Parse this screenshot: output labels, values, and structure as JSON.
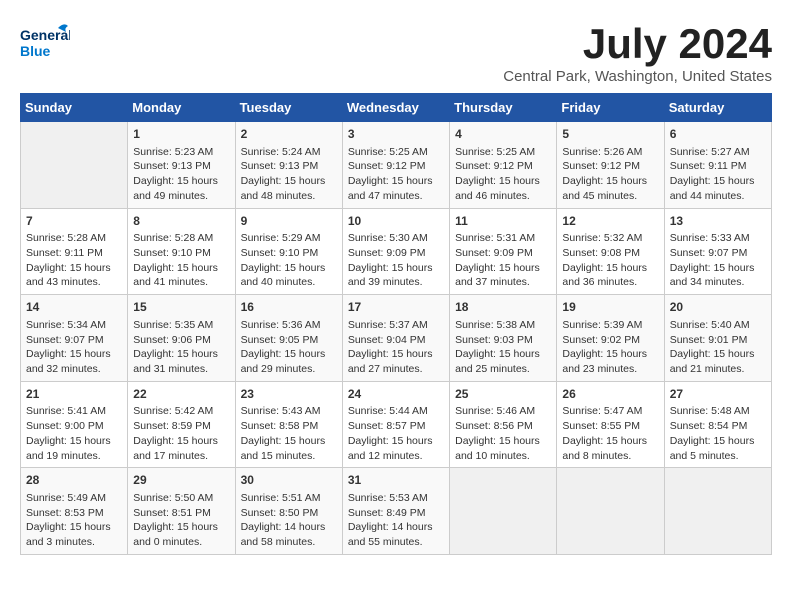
{
  "logo": {
    "line1": "General",
    "line2": "Blue"
  },
  "title": "July 2024",
  "subtitle": "Central Park, Washington, United States",
  "headers": [
    "Sunday",
    "Monday",
    "Tuesday",
    "Wednesday",
    "Thursday",
    "Friday",
    "Saturday"
  ],
  "weeks": [
    [
      {
        "day": "",
        "info": ""
      },
      {
        "day": "1",
        "info": "Sunrise: 5:23 AM\nSunset: 9:13 PM\nDaylight: 15 hours\nand 49 minutes."
      },
      {
        "day": "2",
        "info": "Sunrise: 5:24 AM\nSunset: 9:13 PM\nDaylight: 15 hours\nand 48 minutes."
      },
      {
        "day": "3",
        "info": "Sunrise: 5:25 AM\nSunset: 9:12 PM\nDaylight: 15 hours\nand 47 minutes."
      },
      {
        "day": "4",
        "info": "Sunrise: 5:25 AM\nSunset: 9:12 PM\nDaylight: 15 hours\nand 46 minutes."
      },
      {
        "day": "5",
        "info": "Sunrise: 5:26 AM\nSunset: 9:12 PM\nDaylight: 15 hours\nand 45 minutes."
      },
      {
        "day": "6",
        "info": "Sunrise: 5:27 AM\nSunset: 9:11 PM\nDaylight: 15 hours\nand 44 minutes."
      }
    ],
    [
      {
        "day": "7",
        "info": "Sunrise: 5:28 AM\nSunset: 9:11 PM\nDaylight: 15 hours\nand 43 minutes."
      },
      {
        "day": "8",
        "info": "Sunrise: 5:28 AM\nSunset: 9:10 PM\nDaylight: 15 hours\nand 41 minutes."
      },
      {
        "day": "9",
        "info": "Sunrise: 5:29 AM\nSunset: 9:10 PM\nDaylight: 15 hours\nand 40 minutes."
      },
      {
        "day": "10",
        "info": "Sunrise: 5:30 AM\nSunset: 9:09 PM\nDaylight: 15 hours\nand 39 minutes."
      },
      {
        "day": "11",
        "info": "Sunrise: 5:31 AM\nSunset: 9:09 PM\nDaylight: 15 hours\nand 37 minutes."
      },
      {
        "day": "12",
        "info": "Sunrise: 5:32 AM\nSunset: 9:08 PM\nDaylight: 15 hours\nand 36 minutes."
      },
      {
        "day": "13",
        "info": "Sunrise: 5:33 AM\nSunset: 9:07 PM\nDaylight: 15 hours\nand 34 minutes."
      }
    ],
    [
      {
        "day": "14",
        "info": "Sunrise: 5:34 AM\nSunset: 9:07 PM\nDaylight: 15 hours\nand 32 minutes."
      },
      {
        "day": "15",
        "info": "Sunrise: 5:35 AM\nSunset: 9:06 PM\nDaylight: 15 hours\nand 31 minutes."
      },
      {
        "day": "16",
        "info": "Sunrise: 5:36 AM\nSunset: 9:05 PM\nDaylight: 15 hours\nand 29 minutes."
      },
      {
        "day": "17",
        "info": "Sunrise: 5:37 AM\nSunset: 9:04 PM\nDaylight: 15 hours\nand 27 minutes."
      },
      {
        "day": "18",
        "info": "Sunrise: 5:38 AM\nSunset: 9:03 PM\nDaylight: 15 hours\nand 25 minutes."
      },
      {
        "day": "19",
        "info": "Sunrise: 5:39 AM\nSunset: 9:02 PM\nDaylight: 15 hours\nand 23 minutes."
      },
      {
        "day": "20",
        "info": "Sunrise: 5:40 AM\nSunset: 9:01 PM\nDaylight: 15 hours\nand 21 minutes."
      }
    ],
    [
      {
        "day": "21",
        "info": "Sunrise: 5:41 AM\nSunset: 9:00 PM\nDaylight: 15 hours\nand 19 minutes."
      },
      {
        "day": "22",
        "info": "Sunrise: 5:42 AM\nSunset: 8:59 PM\nDaylight: 15 hours\nand 17 minutes."
      },
      {
        "day": "23",
        "info": "Sunrise: 5:43 AM\nSunset: 8:58 PM\nDaylight: 15 hours\nand 15 minutes."
      },
      {
        "day": "24",
        "info": "Sunrise: 5:44 AM\nSunset: 8:57 PM\nDaylight: 15 hours\nand 12 minutes."
      },
      {
        "day": "25",
        "info": "Sunrise: 5:46 AM\nSunset: 8:56 PM\nDaylight: 15 hours\nand 10 minutes."
      },
      {
        "day": "26",
        "info": "Sunrise: 5:47 AM\nSunset: 8:55 PM\nDaylight: 15 hours\nand 8 minutes."
      },
      {
        "day": "27",
        "info": "Sunrise: 5:48 AM\nSunset: 8:54 PM\nDaylight: 15 hours\nand 5 minutes."
      }
    ],
    [
      {
        "day": "28",
        "info": "Sunrise: 5:49 AM\nSunset: 8:53 PM\nDaylight: 15 hours\nand 3 minutes."
      },
      {
        "day": "29",
        "info": "Sunrise: 5:50 AM\nSunset: 8:51 PM\nDaylight: 15 hours\nand 0 minutes."
      },
      {
        "day": "30",
        "info": "Sunrise: 5:51 AM\nSunset: 8:50 PM\nDaylight: 14 hours\nand 58 minutes."
      },
      {
        "day": "31",
        "info": "Sunrise: 5:53 AM\nSunset: 8:49 PM\nDaylight: 14 hours\nand 55 minutes."
      },
      {
        "day": "",
        "info": ""
      },
      {
        "day": "",
        "info": ""
      },
      {
        "day": "",
        "info": ""
      }
    ]
  ]
}
